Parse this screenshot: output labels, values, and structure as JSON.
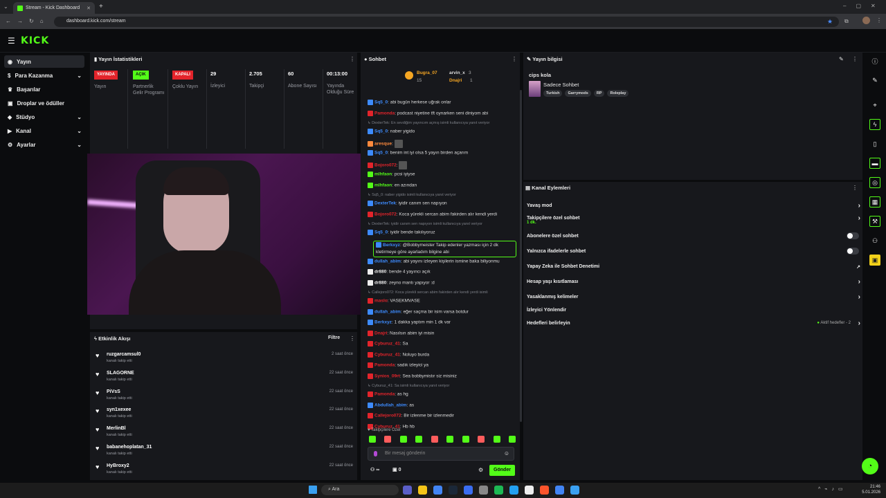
{
  "browser": {
    "tab_title": "Stream - Kick Dashboard",
    "url": "dashboard.kick.com/stream"
  },
  "header": {
    "logo": "KICK"
  },
  "sidebar": {
    "items": [
      {
        "label": "Yayın"
      },
      {
        "label": "Para Kazanma"
      },
      {
        "label": "Başarılar"
      },
      {
        "label": "Droplar ve ödüller"
      },
      {
        "label": "Stüdyo"
      },
      {
        "label": "Kanal"
      },
      {
        "label": "Ayarlar"
      }
    ]
  },
  "stats": {
    "title": "Yayın İstatistikleri",
    "items": [
      {
        "badge": "YAYINDA",
        "label": "Yayın",
        "color": "#e3242b"
      },
      {
        "badge": "AÇIK",
        "label": "Partnerlik Gelir Programı",
        "color": "#53fc18"
      },
      {
        "badge": "KAPALI",
        "label": "Çoklu Yayın",
        "color": "#e3242b"
      },
      {
        "value": "29",
        "label": "İzleyici"
      },
      {
        "value": "2.705",
        "label": "Takipçi"
      },
      {
        "value": "60",
        "label": "Abone Sayısı"
      },
      {
        "value": "00:13:00",
        "label": "Yayında Olduğu Süre"
      }
    ]
  },
  "events": {
    "title": "Etkinlik Akışı",
    "filter": "Filtre",
    "action_text": "kanalı takip etti",
    "items": [
      {
        "name": "ruzgarcamsul0",
        "time": "2 saat önce"
      },
      {
        "name": "SLAGORNE",
        "time": "22 saat önce"
      },
      {
        "name": "PiVsS",
        "time": "22 saat önce"
      },
      {
        "name": "syn1xexee",
        "time": "22 saat önce"
      },
      {
        "name": "MerlinBl",
        "time": "22 saat önce"
      },
      {
        "name": "babanehoplatan_31",
        "time": "22 saat önce"
      },
      {
        "name": "HyBroxy2",
        "time": "22 saat önce"
      }
    ]
  },
  "chat": {
    "title": "Sohbet",
    "top": {
      "user1": "Bugra_07",
      "user1_count": "15",
      "user2": "arvin_x",
      "user2_count": "3",
      "user3": "Dnajri",
      "user3_count": "1"
    },
    "messages": [
      {
        "user": "Sq5_0",
        "color": "#3d8bfd",
        "text": "abi bugün herkese uğrak onlar"
      },
      {
        "user": "Pamonda",
        "color": "#e3242b",
        "text": "podcast niyetine tft oynarken seni diniyom abi"
      },
      {
        "reply": "DexterTek: En sevdiğim yayıncım açmış isimli kullanıcıya yanıt veriyor"
      },
      {
        "user": "Sq5_0",
        "color": "#3d8bfd",
        "text": "naber yigido"
      },
      {
        "user": "aresque",
        "color": "#ff8a3d",
        "text": ""
      },
      {
        "user": "Sq5_0",
        "color": "#3d8bfd",
        "text": "benim int iyi olsa 5 yayın birden açarım"
      },
      {
        "user": "Bojoro072",
        "color": "#e3242b",
        "text": ""
      },
      {
        "user": "mlhfaon",
        "color": "#53fc18",
        "text": "pcsi iyiyse"
      },
      {
        "user": "mlhfaon",
        "color": "#53fc18",
        "text": "en azından"
      },
      {
        "reply": "Sq5_0: naber yigido isimli kullanıcıya yanıt veriyor"
      },
      {
        "user": "DexterTek",
        "color": "#3d8bfd",
        "text": "iyidir canım sen napıyon"
      },
      {
        "user": "Bojoro072",
        "color": "#e3242b",
        "text": "Koca yürekli sercan abim fakirden alır kendi yerdi"
      },
      {
        "reply": "DexterTek: iyidir canım sen napıyon isimli kullanıcıya yanıt veriyor"
      },
      {
        "user": "Sq5_0",
        "color": "#3d8bfd",
        "text": "iyidir bende takılıyoruz"
      },
      {
        "user": "Berkxyz",
        "color": "#3d8bfd",
        "text": "@Bobbymeister Takip edenler yazması için 2 dk kletirmeye göre ayarladım bilgine abi",
        "highlight": true
      },
      {
        "user": "dullah_abim",
        "color": "#3d8bfd",
        "text": "abi yayını izleyen kişilerin ismine baka biliyonmu"
      },
      {
        "user": "dr880",
        "color": "#eeeeee",
        "text": "bende 4 yayıncı açık"
      },
      {
        "user": "dr880",
        "color": "#eeeeee",
        "text": "zeyno mantı yapıyor :d"
      },
      {
        "reply": "Callejoro072: Koca yürekli sercan abim fakirden alır kendi yerdi isimli"
      },
      {
        "user": "maslo",
        "color": "#e3242b",
        "text": "VASEKMVASE"
      },
      {
        "user": "dullah_abim",
        "color": "#3d8bfd",
        "text": "eğer saçma bir isim varsa botdur"
      },
      {
        "user": "Berkxyz",
        "color": "#3d8bfd",
        "text": "1 dakka yaptım min 1 dk var"
      },
      {
        "user": "Dnajri",
        "color": "#e3242b",
        "text": "Nasılsın abim iyi misin"
      },
      {
        "user": "Cyburuz_41",
        "color": "#e3242b",
        "text": "Sa"
      },
      {
        "user": "Cyburuz_41",
        "color": "#e3242b",
        "text": "Noluyo burda"
      },
      {
        "user": "Pamonda",
        "color": "#e3242b",
        "text": "sadık izleyici ya"
      },
      {
        "user": "Synios_09rt",
        "color": "#e3242b",
        "text": "Sea bobbymistır siz misiniz"
      },
      {
        "reply": "Cyburuz_41: Sa isimli kullanıcıya yanıt veriyor"
      },
      {
        "user": "Pamonda",
        "color": "#e3242b",
        "text": "as hg"
      },
      {
        "user": "Abdullah_abim",
        "color": "#3d8bfd",
        "text": "as"
      },
      {
        "user": "Callejoro072",
        "color": "#e3242b",
        "text": "Bir izlenme bir izlenmedir"
      },
      {
        "user": "Cyburuz_41",
        "color": "#e3242b",
        "text": "Hb hb"
      }
    ],
    "follower_only_label": "Takipçilere Özel",
    "input_placeholder": "Bir mesaj gönderin",
    "points": "0",
    "infinity": "∞",
    "send_label": "Gönder"
  },
  "stream_info": {
    "title": "Yayın bilgisi",
    "stream_title": "cips kola",
    "category": "Sadece Sohbet",
    "tags": [
      "Turkish",
      "Garrymods",
      "RP",
      "Roleplay"
    ]
  },
  "channel_actions": {
    "title": "Kanal Eylemleri",
    "items": [
      {
        "label": "Yavaş mod",
        "control": "arrow"
      },
      {
        "label": "Takipçilere özel sohbet",
        "sub": "1 dk.",
        "control": "arrow"
      },
      {
        "label": "Abonelere özel sohbet",
        "control": "toggle"
      },
      {
        "label": "Yalnızca ifadelerle sohbet",
        "control": "toggle"
      },
      {
        "label": "Yapay Zeka ile Sohbet Denetimi",
        "control": "external"
      },
      {
        "label": "Hesap yaşı kısıtlaması",
        "control": "arrow"
      },
      {
        "label": "Yasaklanmış kelimeler",
        "control": "arrow"
      },
      {
        "label": "İzleyici Yönlendir",
        "control": "none"
      },
      {
        "label": "Hedefleri belirleyin",
        "sub_right": "Aktif hedefler - 2",
        "control": "arrow"
      }
    ]
  },
  "taskbar": {
    "search": "Ara",
    "time": "21:46",
    "date": "5.01.2026"
  },
  "colors": {
    "accent": "#53fc18",
    "panel": "#17181c",
    "bg": "#0b0c0e"
  }
}
